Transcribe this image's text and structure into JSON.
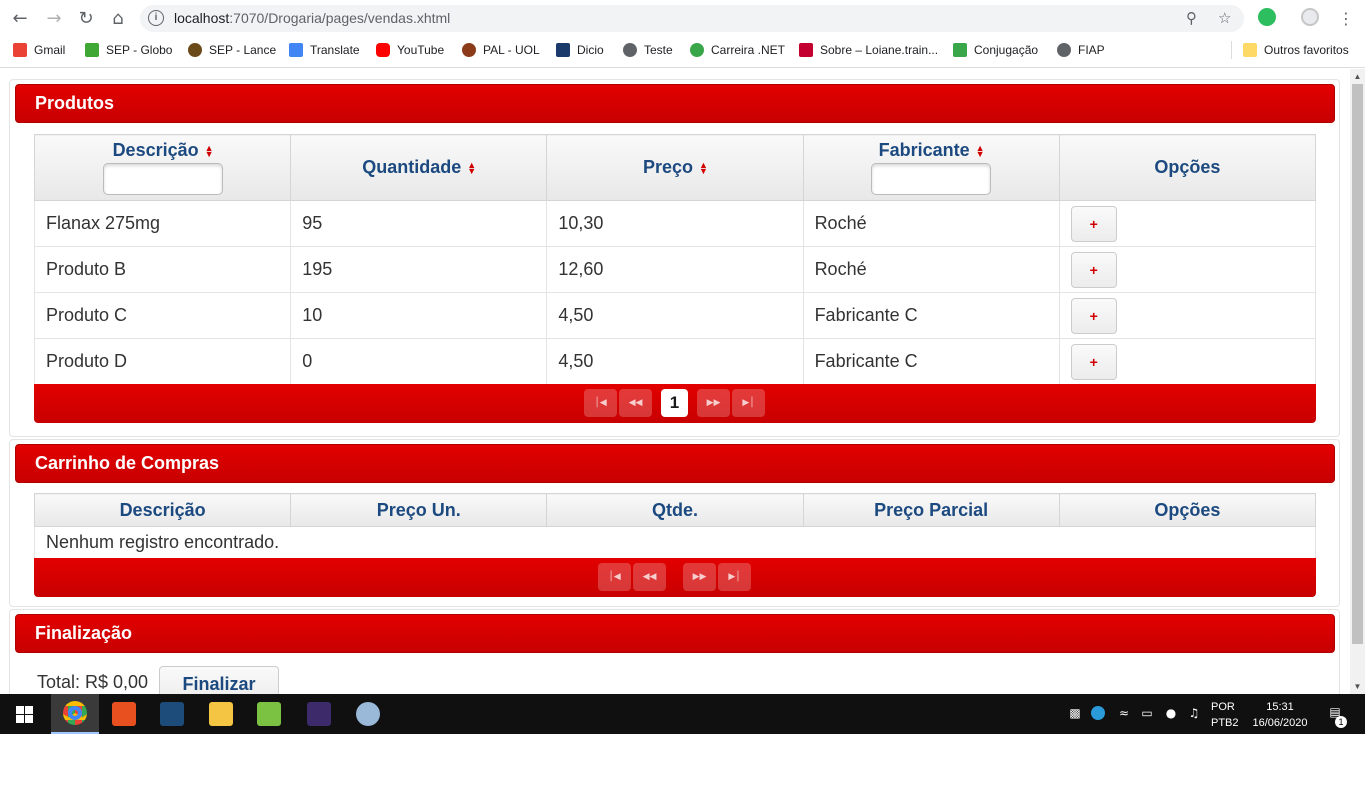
{
  "browser": {
    "url_host": "localhost",
    "url_path": ":7070/Drogaria/pages/vendas.xhtml",
    "bookmarks": [
      {
        "label": "Gmail",
        "color": "#ea4335"
      },
      {
        "label": "SEP - Globo",
        "color": "#3fa733"
      },
      {
        "label": "SEP - Lance",
        "color": "#6b4a1a"
      },
      {
        "label": "Translate",
        "color": "#4285f4"
      },
      {
        "label": "YouTube",
        "color": "#ff0000"
      },
      {
        "label": "PAL - UOL",
        "color": "#8b3a1a"
      },
      {
        "label": "Dicio",
        "color": "#1a3a6b"
      },
      {
        "label": "Teste",
        "color": "#5f6368"
      },
      {
        "label": "Carreira .NET",
        "color": "#3aa64a"
      },
      {
        "label": "Sobre – Loiane.train...",
        "color": "#c3002f"
      },
      {
        "label": "Conjugação",
        "color": "#3aa64a"
      },
      {
        "label": "FIAP",
        "color": "#5f6368"
      }
    ],
    "other_bookmarks": "Outros favoritos"
  },
  "produtos": {
    "title": "Produtos",
    "columns": {
      "descricao": "Descrição",
      "quantidade": "Quantidade",
      "preco": "Preço",
      "fabricante": "Fabricante",
      "opcoes": "Opções"
    },
    "rows": [
      {
        "descricao": "Flanax 275mg",
        "quantidade": "95",
        "preco": "10,30",
        "fabricante": "Roché",
        "action": "+"
      },
      {
        "descricao": "Produto B",
        "quantidade": "195",
        "preco": "12,60",
        "fabricante": "Roché",
        "action": "+"
      },
      {
        "descricao": "Produto C",
        "quantidade": "10",
        "preco": "4,50",
        "fabricante": "Fabricante C",
        "action": "+"
      },
      {
        "descricao": "Produto D",
        "quantidade": "0",
        "preco": "4,50",
        "fabricante": "Fabricante C",
        "action": "+"
      }
    ],
    "paginator": {
      "current_page": "1"
    }
  },
  "carrinho": {
    "title": "Carrinho de Compras",
    "columns": {
      "descricao": "Descrição",
      "preco_un": "Preço Un.",
      "qtde": "Qtde.",
      "preco_parcial": "Preço Parcial",
      "opcoes": "Opções"
    },
    "empty_message": "Nenhum registro encontrado."
  },
  "finalizacao": {
    "title": "Finalização",
    "total_label": "Total: R$ 0,00",
    "finalizar_label": "Finalizar"
  },
  "taskbar": {
    "language_top": "POR",
    "language_bottom": "PTB2",
    "time": "15:31",
    "date": "16/06/2020",
    "notification_count": "1"
  },
  "icons": {
    "back": "arrow-left-icon",
    "forward": "arrow-right-icon",
    "reload": "reload-icon",
    "home": "home-icon",
    "sort": "sort-icon",
    "paginator_first": "first-page-icon",
    "paginator_prev": "prev-page-icon",
    "paginator_next": "next-page-icon",
    "paginator_last": "last-page-icon"
  }
}
